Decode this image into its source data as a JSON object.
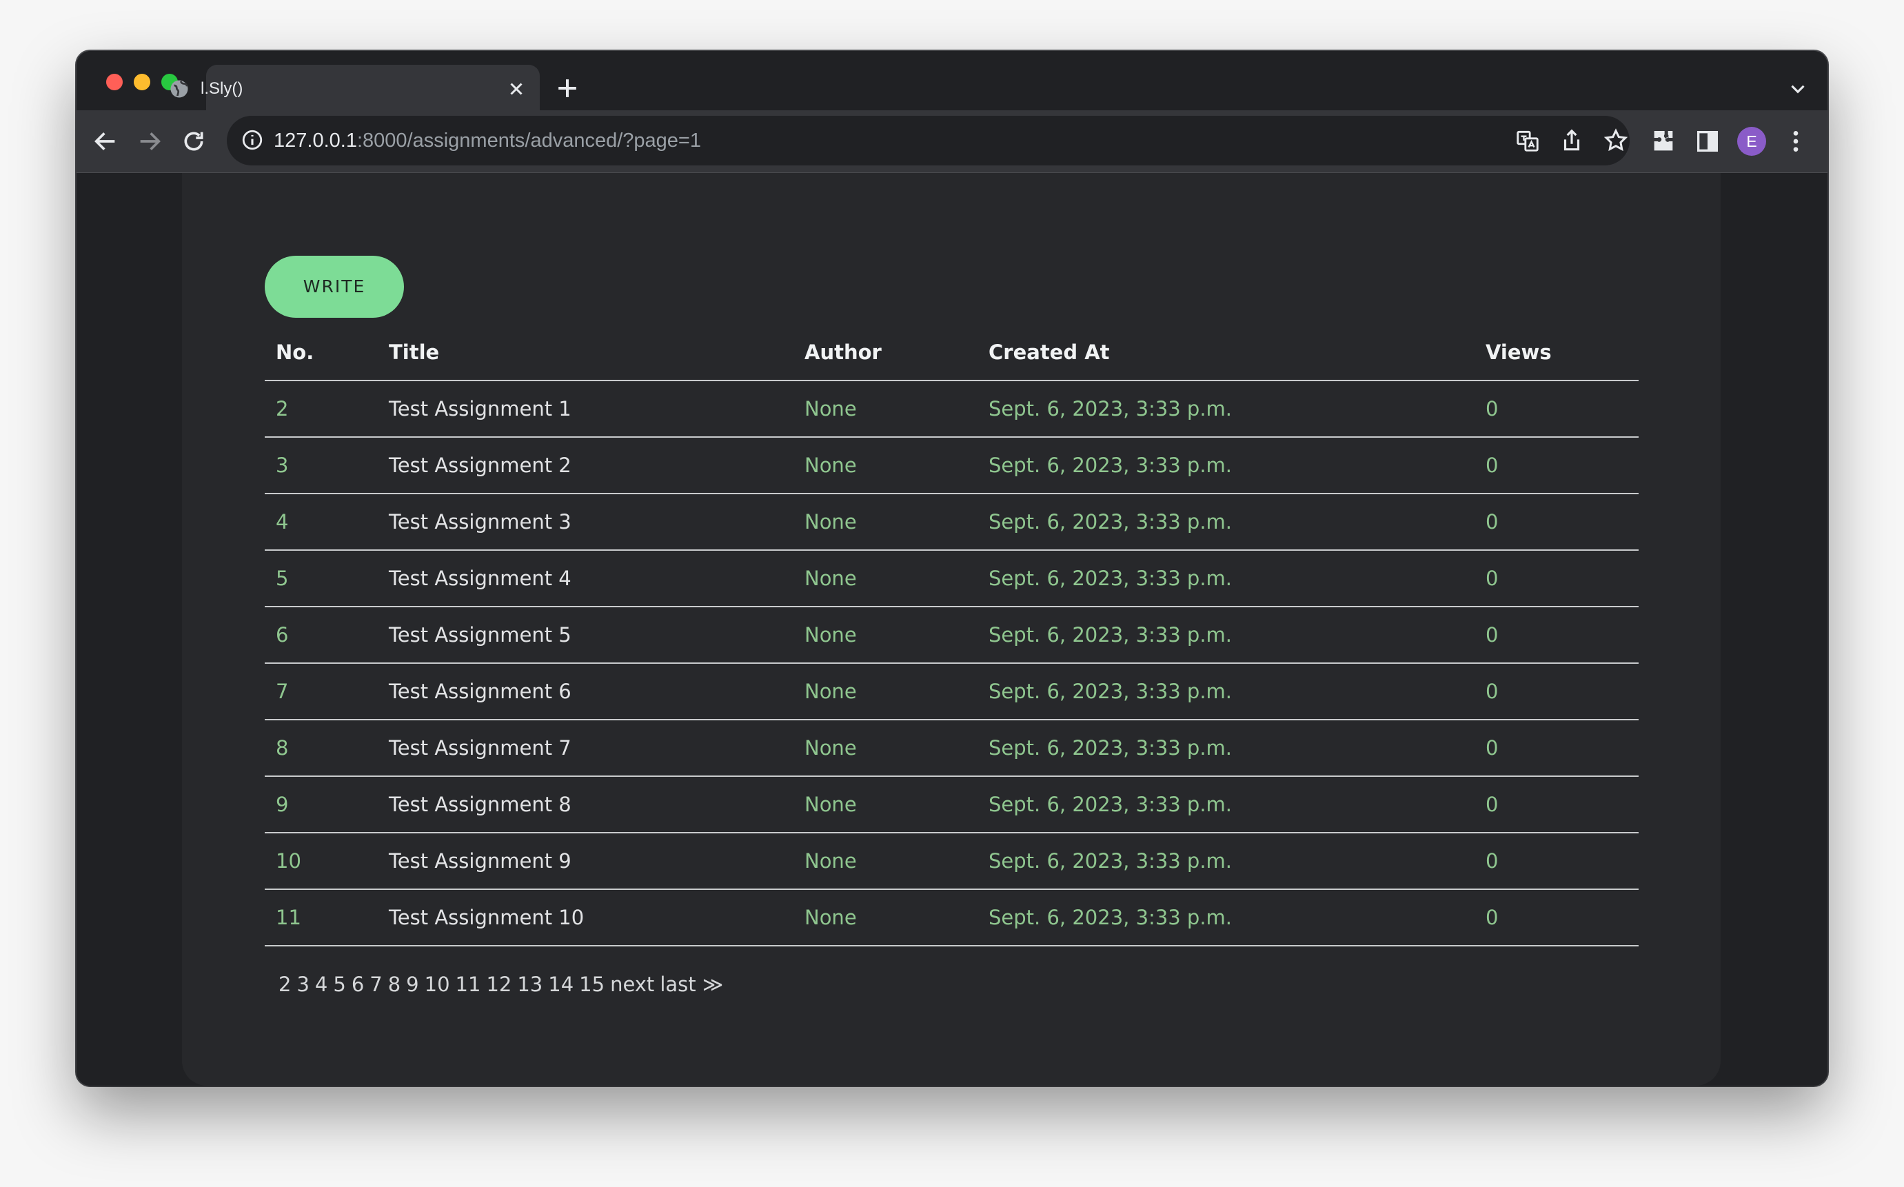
{
  "browser": {
    "tab_title": "l.Sly()",
    "url_host": "127.0.0.1",
    "url_rest": ":8000/assignments/advanced/?page=1",
    "avatar_letter": "E"
  },
  "page": {
    "write_label": "WRITE",
    "columns": [
      "No.",
      "Title",
      "Author",
      "Created At",
      "Views"
    ],
    "rows": [
      {
        "no": "2",
        "title": "Test Assignment 1",
        "author": "None",
        "created": "Sept. 6, 2023, 3:33 p.m.",
        "views": "0"
      },
      {
        "no": "3",
        "title": "Test Assignment 2",
        "author": "None",
        "created": "Sept. 6, 2023, 3:33 p.m.",
        "views": "0"
      },
      {
        "no": "4",
        "title": "Test Assignment 3",
        "author": "None",
        "created": "Sept. 6, 2023, 3:33 p.m.",
        "views": "0"
      },
      {
        "no": "5",
        "title": "Test Assignment 4",
        "author": "None",
        "created": "Sept. 6, 2023, 3:33 p.m.",
        "views": "0"
      },
      {
        "no": "6",
        "title": "Test Assignment 5",
        "author": "None",
        "created": "Sept. 6, 2023, 3:33 p.m.",
        "views": "0"
      },
      {
        "no": "7",
        "title": "Test Assignment 6",
        "author": "None",
        "created": "Sept. 6, 2023, 3:33 p.m.",
        "views": "0"
      },
      {
        "no": "8",
        "title": "Test Assignment 7",
        "author": "None",
        "created": "Sept. 6, 2023, 3:33 p.m.",
        "views": "0"
      },
      {
        "no": "9",
        "title": "Test Assignment 8",
        "author": "None",
        "created": "Sept. 6, 2023, 3:33 p.m.",
        "views": "0"
      },
      {
        "no": "10",
        "title": "Test Assignment 9",
        "author": "None",
        "created": "Sept. 6, 2023, 3:33 p.m.",
        "views": "0"
      },
      {
        "no": "11",
        "title": "Test Assignment 10",
        "author": "None",
        "created": "Sept. 6, 2023, 3:33 p.m.",
        "views": "0"
      }
    ],
    "pagination": [
      "2",
      "3",
      "4",
      "5",
      "6",
      "7",
      "8",
      "9",
      "10",
      "11",
      "12",
      "13",
      "14",
      "15",
      "next",
      "last ≫"
    ]
  }
}
